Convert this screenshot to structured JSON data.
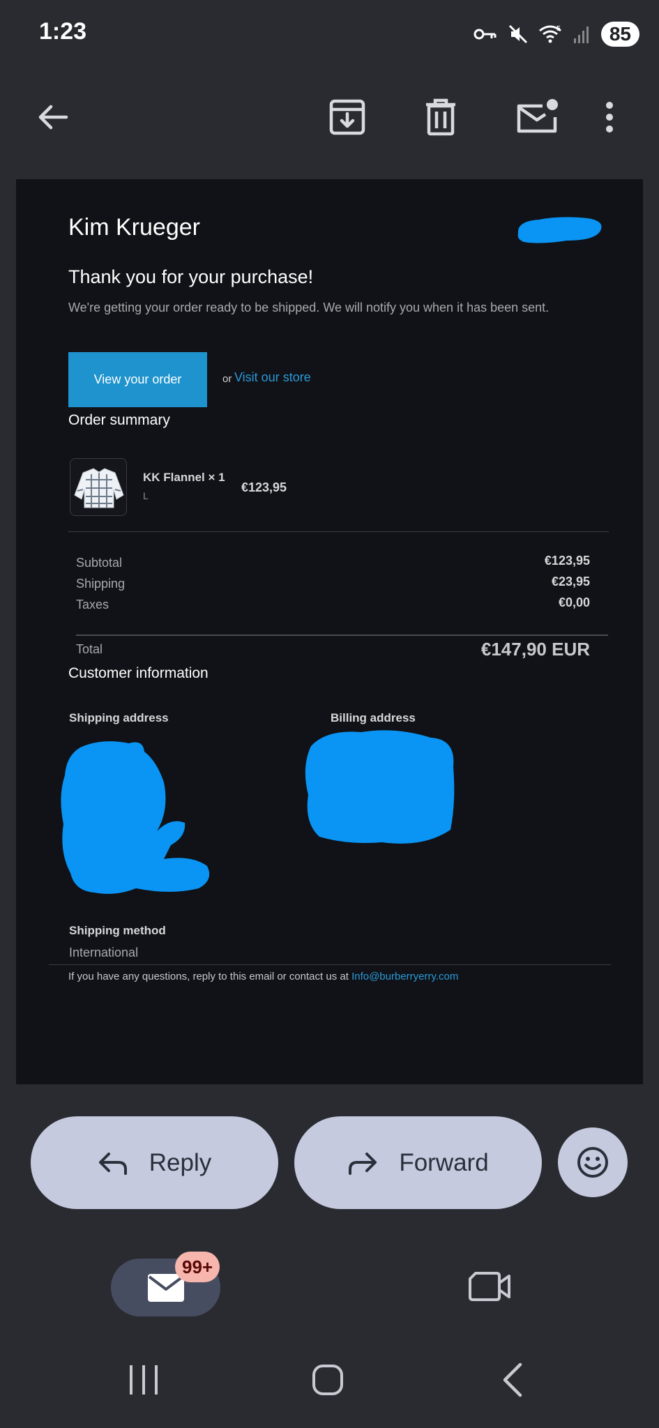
{
  "status_bar": {
    "time": "1:23",
    "battery": "85",
    "icons": [
      "vpn-key-icon",
      "mute-icon",
      "wifi-icon",
      "signal-icon"
    ]
  },
  "toolbar": {
    "back_icon": "back-arrow-icon",
    "archive_icon": "archive-icon",
    "delete_icon": "trash-icon",
    "mark_unread_icon": "mark-unread-icon",
    "more_icon": "more-vert-icon"
  },
  "email": {
    "sender_name": "Kim Krueger",
    "title": "Thank you for your purchase!",
    "subtitle": "We're getting your order ready to be shipped. We will notify you when it has been sent.",
    "view_order_label": "View your order",
    "or_text": "or",
    "visit_store_label": "Visit our store",
    "order_summary_title": "Order summary",
    "product": {
      "name": "KK Flannel × 1",
      "variant": "L",
      "price": "€123,95"
    },
    "totals": [
      {
        "label": "Subtotal",
        "value": "€123,95"
      },
      {
        "label": "Shipping",
        "value": "€23,95"
      },
      {
        "label": "Taxes",
        "value": "€0,00"
      }
    ],
    "total_label": "Total",
    "total_value": "€147,90 EUR",
    "customer_info_title": "Customer information",
    "shipping_address_label": "Shipping address",
    "billing_address_label": "Billing address",
    "shipping_method_label": "Shipping method",
    "shipping_method_value": "International",
    "footer_text": "If you have any questions, reply to this email or contact us at ",
    "footer_email": "Info@burberryerry.com"
  },
  "actions": {
    "reply_label": "Reply",
    "forward_label": "Forward",
    "emoji_icon": "emoji-icon"
  },
  "bottom_nav": {
    "mail_badge": "99+",
    "mail_icon": "mail-icon",
    "video_icon": "video-icon"
  },
  "system_nav": {
    "recents_icon": "recents-icon",
    "home_icon": "home-icon",
    "back_icon": "back-chevron-icon"
  },
  "colors": {
    "background": "#2a2b31",
    "card": "#101217",
    "accent": "#1e93cd",
    "link": "#2a9ad8",
    "pill": "#c5cadf",
    "badge": "#f7b6ad",
    "redaction": "#0a95f5"
  }
}
